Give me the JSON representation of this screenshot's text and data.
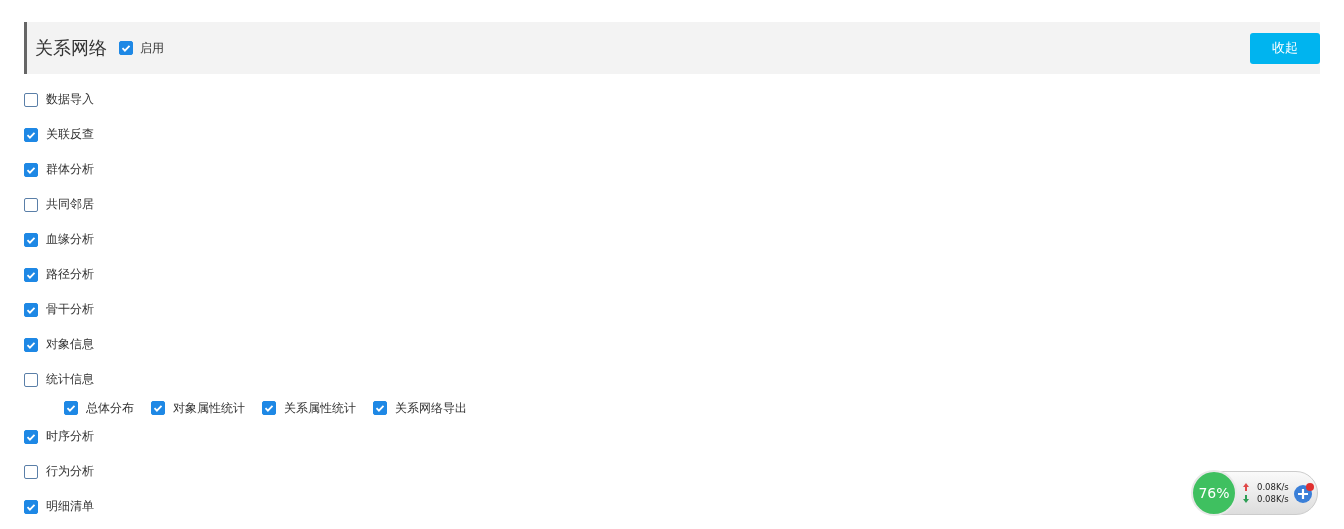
{
  "header": {
    "title": "关系网络",
    "enable": {
      "label": "启用",
      "checked": true
    },
    "collapse_button": "收起"
  },
  "items": [
    {
      "label": "数据导入",
      "checked": false
    },
    {
      "label": "关联反查",
      "checked": true
    },
    {
      "label": "群体分析",
      "checked": true
    },
    {
      "label": "共同邻居",
      "checked": false
    },
    {
      "label": "血缘分析",
      "checked": true
    },
    {
      "label": "路径分析",
      "checked": true
    },
    {
      "label": "骨干分析",
      "checked": true
    },
    {
      "label": "对象信息",
      "checked": true
    },
    {
      "label": "统计信息",
      "checked": false,
      "children": [
        {
          "label": "总体分布",
          "checked": true
        },
        {
          "label": "对象属性统计",
          "checked": true
        },
        {
          "label": "关系属性统计",
          "checked": true
        },
        {
          "label": "关系网络导出",
          "checked": true
        }
      ]
    },
    {
      "label": "时序分析",
      "checked": true
    },
    {
      "label": "行为分析",
      "checked": false
    },
    {
      "label": "明细清单",
      "checked": true
    }
  ],
  "speed_widget": {
    "percent": "76%",
    "upload": "0.08K/s",
    "download": "0.08K/s"
  }
}
